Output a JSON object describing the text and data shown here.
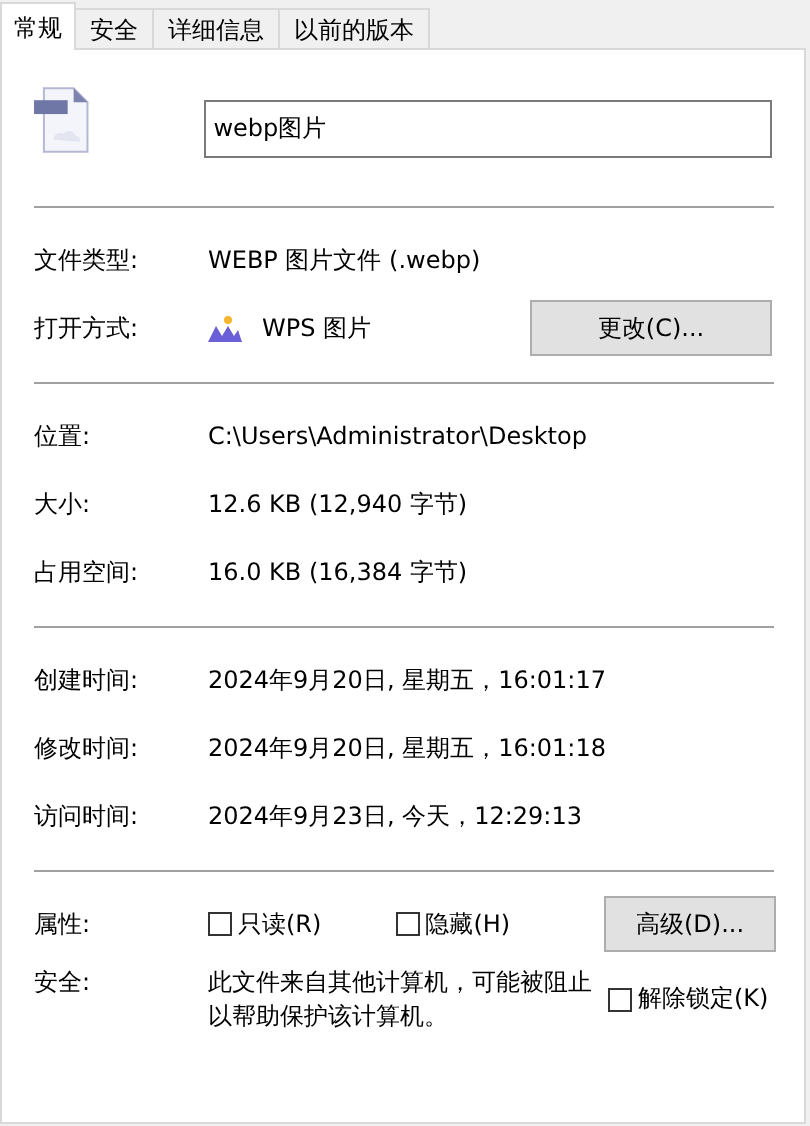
{
  "tabs": [
    {
      "label": "常规",
      "selected": true
    },
    {
      "label": "安全",
      "selected": false
    },
    {
      "label": "详细信息",
      "selected": false
    },
    {
      "label": "以前的版本",
      "selected": false
    }
  ],
  "file_name": {
    "value": "webp图片"
  },
  "sections": [
    [
      {
        "kind": "text",
        "label": "文件类型:",
        "value": "WEBP 图片文件 (.webp)"
      },
      {
        "kind": "app",
        "label": "打开方式:",
        "value": "WPS 图片",
        "button": "更改(C)..."
      }
    ],
    [
      {
        "kind": "text",
        "label": "位置:",
        "value": "C:\\Users\\Administrator\\Desktop"
      },
      {
        "kind": "text",
        "label": "大小:",
        "value": "12.6 KB (12,940 字节)"
      },
      {
        "kind": "text",
        "label": "占用空间:",
        "value": "16.0 KB (16,384 字节)"
      }
    ],
    [
      {
        "kind": "text",
        "label": "创建时间:",
        "value": "2024年9月20日, 星期五，16:01:17"
      },
      {
        "kind": "text",
        "label": "修改时间:",
        "value": "2024年9月20日, 星期五，16:01:18"
      },
      {
        "kind": "text",
        "label": "访问时间:",
        "value": "2024年9月23日, 今天，12:29:13"
      }
    ],
    [
      {
        "kind": "attributes",
        "label": "属性:",
        "checkboxes": [
          {
            "label": "只读(R)",
            "checked": false
          },
          {
            "label": "隐藏(H)",
            "checked": false
          }
        ],
        "button": "高级(D)..."
      },
      {
        "kind": "security",
        "label": "安全:",
        "value": "此文件来自其他计算机，可能被阻止以帮助保护该计算机。",
        "checkbox": {
          "label": "解除锁定(K)",
          "checked": false
        }
      }
    ]
  ]
}
